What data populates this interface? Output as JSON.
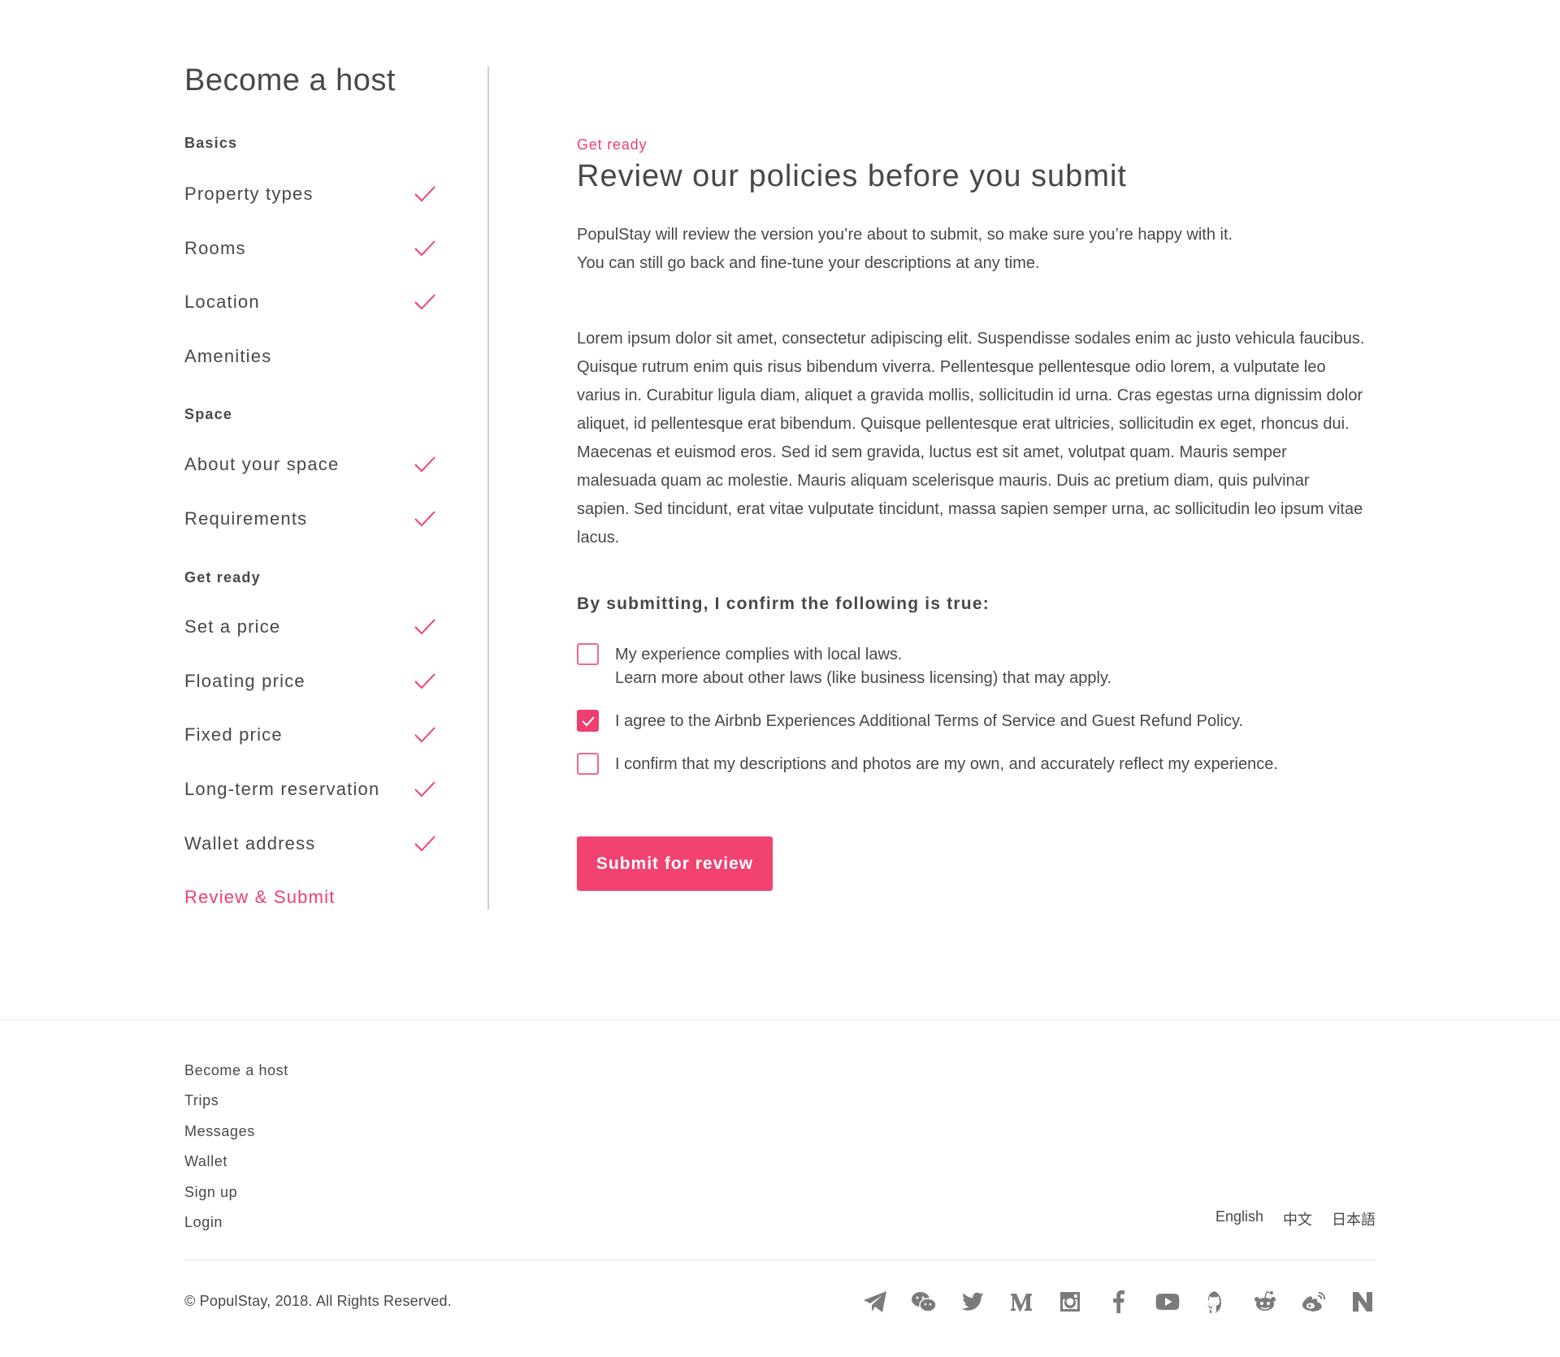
{
  "sidebar": {
    "title": "Become a host",
    "sections": [
      {
        "label": "Basics",
        "items": [
          {
            "label": "Property types",
            "done": true
          },
          {
            "label": "Rooms",
            "done": true
          },
          {
            "label": "Location",
            "done": true
          },
          {
            "label": "Amenities",
            "done": false
          }
        ]
      },
      {
        "label": "Space",
        "items": [
          {
            "label": "About your space",
            "done": true
          },
          {
            "label": "Requirements",
            "done": true
          }
        ]
      },
      {
        "label": "Get ready",
        "items": [
          {
            "label": "Set a price",
            "done": true
          },
          {
            "label": "Floating price",
            "done": true
          },
          {
            "label": "Fixed price",
            "done": true
          },
          {
            "label": "Long-term reservation",
            "done": true
          },
          {
            "label": "Wallet address",
            "done": true
          },
          {
            "label": "Review & Submit",
            "done": false,
            "active": true
          }
        ]
      }
    ]
  },
  "main": {
    "eyebrow": "Get ready",
    "title": "Review our policies before you submit",
    "intro_line1": "PopulStay will review the version you’re about to submit, so make sure you’re happy with it.",
    "intro_line2": "You can still go back and fine-tune your descriptions at any time.",
    "lorem": "Lorem ipsum dolor sit amet, consectetur adipiscing elit. Suspendisse sodales enim ac justo vehicula faucibus. Quisque rutrum enim quis risus bibendum viverra. Pellentesque pellentesque odio lorem, a vulputate leo varius in. Curabitur ligula diam, aliquet a gravida mollis, sollicitudin id urna. Cras egestas urna dignissim dolor aliquet, id pellentesque erat bibendum. Quisque pellentesque erat ultricies, sollicitudin ex eget, rhoncus dui. Maecenas et euismod eros. Sed id sem gravida, luctus est sit amet, volutpat quam. Mauris semper malesuada quam ac molestie. Mauris aliquam scelerisque mauris. Duis ac pretium diam, quis pulvinar sapien. Sed tincidunt, erat vitae vulputate tincidunt, massa sapien semper urna, ac sollicitudin leo ipsum vitae lacus.",
    "confirm_heading": "By submitting, I confirm the following is true:",
    "checks": [
      {
        "line1": "My experience complies with local laws.",
        "line2": "Learn more about other laws (like business licensing) that may apply.",
        "checked": false
      },
      {
        "line1": "I agree to the Airbnb Experiences Additional Terms of Service and Guest Refund Policy.",
        "line2": "",
        "checked": true
      },
      {
        "line1": "I confirm that my descriptions and photos are my own, and accurately reflect my experience.",
        "line2": "",
        "checked": false
      }
    ],
    "submit_label": "Submit for review"
  },
  "footer": {
    "links": [
      "Become a host",
      "Trips",
      "Messages",
      "Wallet",
      "Sign up",
      "Login"
    ],
    "languages": [
      "English",
      "中文",
      "日本語"
    ],
    "copyright": "© PopulStay, 2018. All Rights Reserved.",
    "social_icons": [
      "telegram-icon",
      "wechat-icon",
      "twitter-icon",
      "medium-icon",
      "instagram-icon",
      "facebook-icon",
      "youtube-icon",
      "github-icon",
      "reddit-icon",
      "weibo-icon",
      "n-icon"
    ]
  },
  "colors": {
    "accent": "#ef3f6e",
    "text": "#484848",
    "icon": "#7b7b7b"
  }
}
